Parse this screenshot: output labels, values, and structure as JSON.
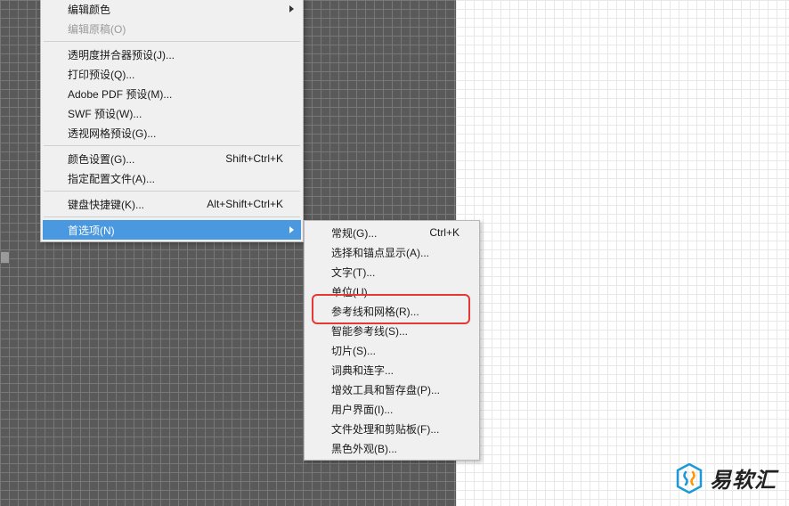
{
  "menus": {
    "main": {
      "items": {
        "edit_colors": "编辑颜色",
        "edit_original": "编辑原稿(O)",
        "transparency_flattener": "透明度拼合器预设(J)...",
        "print_presets": "打印预设(Q)...",
        "adobe_pdf_presets": "Adobe PDF 预设(M)...",
        "swf_presets": "SWF 预设(W)...",
        "perspective_grid_presets": "透视网格预设(G)...",
        "color_settings": "颜色设置(G)...",
        "color_settings_shortcut": "Shift+Ctrl+K",
        "assign_profile": "指定配置文件(A)...",
        "keyboard_shortcuts": "键盘快捷键(K)...",
        "keyboard_shortcuts_shortcut": "Alt+Shift+Ctrl+K",
        "preferences": "首选项(N)"
      }
    },
    "sub": {
      "items": {
        "general": "常规(G)...",
        "general_shortcut": "Ctrl+K",
        "selection_anchor": "选择和锚点显示(A)...",
        "type": "文字(T)...",
        "units": "单位(U)...",
        "guides_grid": "参考线和网格(R)...",
        "smart_guides": "智能参考线(S)...",
        "slices": "切片(S)...",
        "dictionary_hyphenation": "词典和连字...",
        "plugins_scratch": "增效工具和暂存盘(P)...",
        "user_interface": "用户界面(I)...",
        "file_handling": "文件处理和剪贴板(F)...",
        "black_appearance": "黑色外观(B)..."
      }
    }
  },
  "watermark": {
    "text": "易软汇"
  }
}
